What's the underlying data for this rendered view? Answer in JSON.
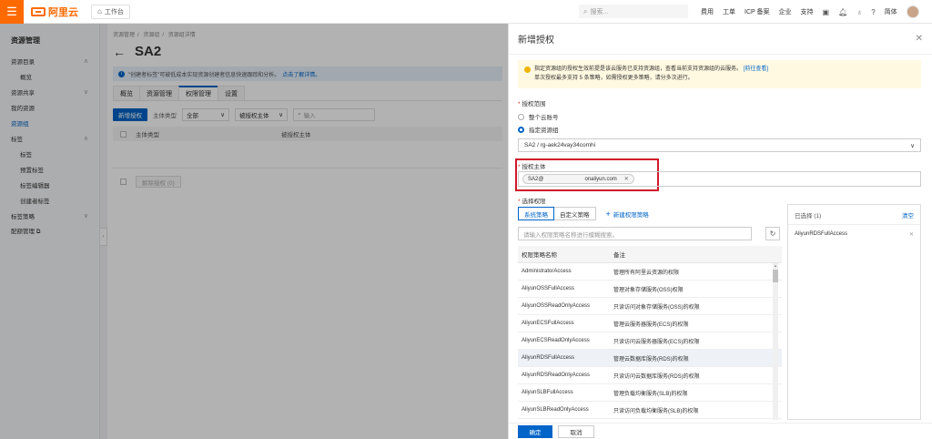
{
  "topbar": {
    "logo_text": "阿里云",
    "workbench": "工作台",
    "search_placeholder": "搜索...",
    "links": [
      "费用",
      "工单",
      "ICP 备案",
      "企业",
      "支持"
    ],
    "lang": "简体"
  },
  "sidebar": {
    "title": "资源管理",
    "items": [
      {
        "label": "资源目录",
        "chev": "∧",
        "sub": false,
        "active": false
      },
      {
        "label": "概览",
        "chev": "",
        "sub": true,
        "active": false
      },
      {
        "label": "资源共享",
        "chev": "∨",
        "sub": false,
        "active": false
      },
      {
        "label": "我的资源",
        "chev": "",
        "sub": false,
        "active": false
      },
      {
        "label": "资源组",
        "chev": "",
        "sub": false,
        "active": true
      },
      {
        "label": "标签",
        "chev": "∧",
        "sub": false,
        "active": false
      },
      {
        "label": "标签",
        "chev": "",
        "sub": true,
        "active": false
      },
      {
        "label": "预置标签",
        "chev": "",
        "sub": true,
        "active": false
      },
      {
        "label": "标签编辑器",
        "chev": "",
        "sub": true,
        "active": false
      },
      {
        "label": "创建者标签",
        "chev": "",
        "sub": true,
        "active": false
      },
      {
        "label": "标签策略",
        "chev": "∨",
        "sub": false,
        "active": false
      },
      {
        "label": "配额管理 ⧉",
        "chev": "",
        "sub": false,
        "active": false
      }
    ]
  },
  "main": {
    "breadcrumb": [
      "资源管理",
      "资源组",
      "资源组详情"
    ],
    "title": "SA2",
    "info": "\"创建者标签\"可被低成本实现资源创建者信息快速跟踪和分析。",
    "info_link": "点击了解详情。",
    "tabs": [
      "概览",
      "资源管理",
      "权限管理",
      "设置"
    ],
    "active_tab": 2,
    "add_button": "新增授权",
    "principal_type_label": "主体类型",
    "principal_type_value": "全部",
    "filter_select": "被授权主体",
    "filter_placeholder": "输入",
    "table_headers": [
      "主体类型",
      "被授权主体"
    ],
    "bulk_button": "解除授权 (0)"
  },
  "drawer": {
    "title": "新增授权",
    "notice_line1": "指定资源组的授权生效前提是该云服务已支持资源组，查看当前支持资源组的云服务。",
    "notice_link": "[前往查看]",
    "notice_line2": "单次授权最多支持 5 条策略，如需授权更多策略，请分多次进行。",
    "scope_label": "授权范围",
    "scope_option1": "整个云账号",
    "scope_option2": "指定资源组",
    "resource_group": "SA2 / rg-aek24vay34comhi",
    "principal_label": "授权主体",
    "principal_tag_start": "SA2@",
    "principal_tag_end": "onaliyun.com",
    "policy_label": "选择权限",
    "policy_tab1": "系统策略",
    "policy_tab2": "自定义策略",
    "new_policy": "新建权限策略",
    "policy_search_placeholder": "请输入权限策略名称进行模糊搜索。",
    "policy_table_headers": [
      "权限策略名称",
      "备注"
    ],
    "policies": [
      {
        "name": "AdministratorAccess",
        "note": "管理所有阿里云资源的权限",
        "selected": false
      },
      {
        "name": "AliyunOSSFullAccess",
        "note": "管理对象存储服务(OSS)权限",
        "selected": false
      },
      {
        "name": "AliyunOSSReadOnlyAccess",
        "note": "只读访问对象存储服务(OSS)的权限",
        "selected": false
      },
      {
        "name": "AliyunECSFullAccess",
        "note": "管理云服务器服务(ECS)的权限",
        "selected": false
      },
      {
        "name": "AliyunECSReadOnlyAccess",
        "note": "只读访问云服务器服务(ECS)的权限",
        "selected": false
      },
      {
        "name": "AliyunRDSFullAccess",
        "note": "管理云数据库服务(RDS)的权限",
        "selected": true
      },
      {
        "name": "AliyunRDSReadOnlyAccess",
        "note": "只读访问云数据库服务(RDS)的权限",
        "selected": false
      },
      {
        "name": "AliyunSLBFullAccess",
        "note": "管理负载均衡服务(SLB)的权限",
        "selected": false
      },
      {
        "name": "AliyunSLBReadOnlyAccess",
        "note": "只读访问负载均衡服务(SLB)的权限",
        "selected": false
      }
    ],
    "selected_label": "已选择",
    "selected_count": "(1)",
    "clear": "清空",
    "selected_items": [
      "AliyunRDSFullAccess"
    ],
    "ok": "确定",
    "cancel": "取消"
  },
  "colors": {
    "brand": "#ff6a00",
    "primary": "#0064c8",
    "highlight_box": "#d0192a"
  }
}
